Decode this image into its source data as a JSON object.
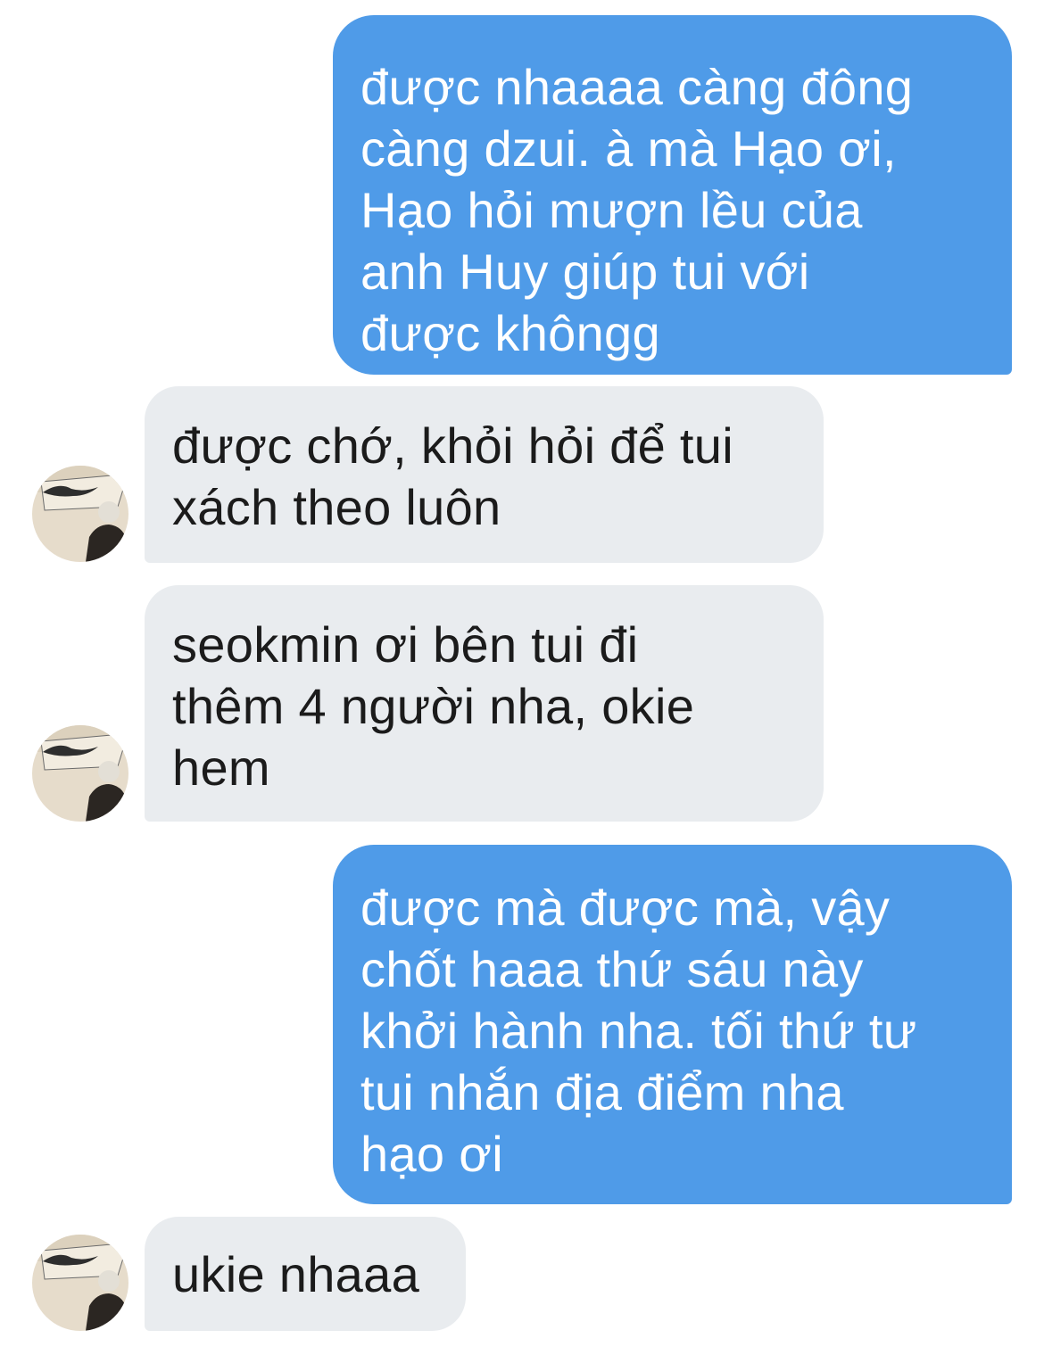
{
  "messages": [
    {
      "direction": "outgoing",
      "text": "được nhaaaa càng đông\ncàng dzui. à mà Hạo ơi,\nHạo hỏi mượn lều của\nanh Huy giúp tui với\nđược khôngg"
    },
    {
      "direction": "incoming",
      "text": "được chớ, khỏi hỏi để tui\nxách theo luôn",
      "avatar": "profile-photo"
    },
    {
      "direction": "incoming",
      "text": "seokmin ơi bên tui đi\nthêm 4 người nha, okie\nhem",
      "avatar": "profile-photo"
    },
    {
      "direction": "outgoing",
      "text": "được mà được mà, vậy\nchốt haaa thứ sáu này\nkhởi hành nha. tối thứ tư\ntui nhắn địa điểm nha\nhạo ơi"
    },
    {
      "direction": "incoming",
      "text": "ukie nhaaa",
      "avatar": "profile-photo"
    }
  ],
  "colors": {
    "outgoing_bubble": "#4f9be8",
    "incoming_bubble": "#e9ecef",
    "outgoing_text": "#ffffff",
    "incoming_text": "#1b1b1b"
  }
}
